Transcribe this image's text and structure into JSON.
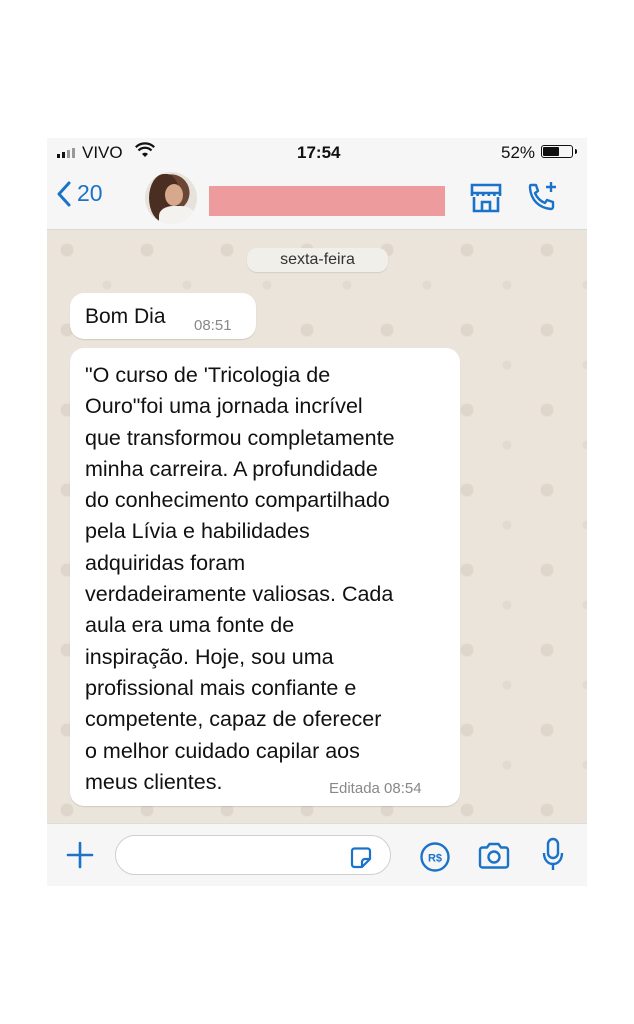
{
  "status_bar": {
    "carrier": "VIVO",
    "time": "17:54",
    "battery_percent": "52%",
    "battery_level": 0.52
  },
  "header": {
    "back_count": "20"
  },
  "chat": {
    "date_separator": "sexta-feira",
    "messages": [
      {
        "text": "Bom Dia",
        "time": "08:51"
      },
      {
        "text": "\"O curso de 'Tricologia de\nOuro\"foi uma jornada incrível\nque transformou completamente\nminha carreira. A profundidade\ndo conhecimento compartilhado\npela Lívia e habilidades\nadquiridas foram\nverdadeiramente valiosas. Cada\naula era uma fonte de\ninspiração. Hoje, sou uma\nprofissional mais confiante e\ncompetente, capaz de oferecer\no melhor cuidado capilar aos\nmeus clientes.",
        "time": "Editada 08:54"
      }
    ]
  },
  "input_bar": {
    "message_value": ""
  },
  "colors": {
    "accent": "#1a73c9",
    "chat_background": "#ebe4da",
    "redaction": "#ee9b9d"
  },
  "icons": [
    "signal-icon",
    "wifi-icon",
    "battery-icon",
    "back-chevron-icon",
    "store-icon",
    "voice-call-icon",
    "plus-icon",
    "sticker-icon",
    "money-icon",
    "camera-icon",
    "microphone-icon"
  ]
}
